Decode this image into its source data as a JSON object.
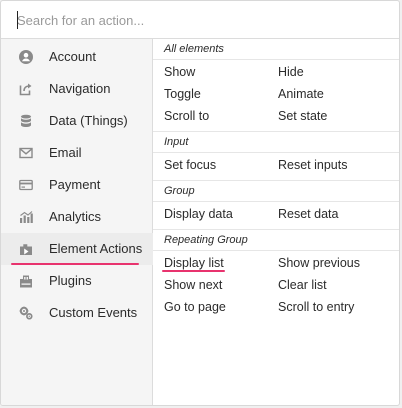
{
  "search": {
    "placeholder": "Search for an action...",
    "value": ""
  },
  "sidebar": {
    "items": [
      {
        "label": "Account",
        "icon": "account-icon"
      },
      {
        "label": "Navigation",
        "icon": "navigation-icon"
      },
      {
        "label": "Data (Things)",
        "icon": "database-icon"
      },
      {
        "label": "Email",
        "icon": "email-icon"
      },
      {
        "label": "Payment",
        "icon": "payment-icon"
      },
      {
        "label": "Analytics",
        "icon": "analytics-icon"
      },
      {
        "label": "Element Actions",
        "icon": "element-actions-icon",
        "active": true
      },
      {
        "label": "Plugins",
        "icon": "plugins-icon"
      },
      {
        "label": "Custom Events",
        "icon": "custom-events-icon"
      }
    ]
  },
  "main": {
    "sections": [
      {
        "title": "All elements",
        "actions": [
          "Show",
          "Hide",
          "Toggle",
          "Animate",
          "Scroll to",
          "Set state"
        ]
      },
      {
        "title": "Input",
        "actions": [
          "Set focus",
          "Reset inputs"
        ]
      },
      {
        "title": "Group",
        "actions": [
          "Display data",
          "Reset data"
        ]
      },
      {
        "title": "Repeating Group",
        "actions": [
          "Display list",
          "Show previous",
          "Show next",
          "Clear list",
          "Go to page",
          "Scroll to entry"
        ]
      }
    ]
  },
  "colors": {
    "highlight_underline": "#e8336e",
    "sidebar_bg": "#f5f5f5",
    "icon_gray": "#8a8a8a"
  }
}
